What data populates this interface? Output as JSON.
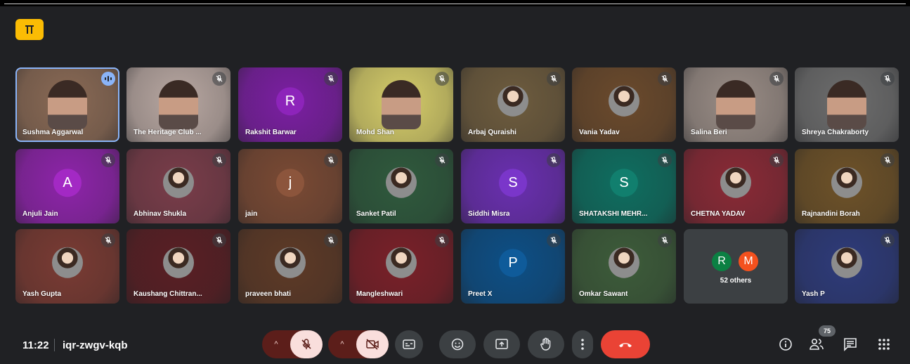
{
  "meeting": {
    "time": "11:22",
    "code": "iqr-zwgv-kqb",
    "participant_count": "75"
  },
  "tiles": [
    {
      "name": "Sushma Aggarwal",
      "icon": "speaking-icon",
      "bg": "#8a6a55",
      "kind": "video"
    },
    {
      "name": "The Heritage Club ...",
      "icon": "mic-off-icon",
      "bg": "#b9a8a2",
      "kind": "video"
    },
    {
      "name": "Rakshit Barwar",
      "icon": "mic-off-icon",
      "bg": "#7b1fa2",
      "kind": "letter",
      "letter": "R"
    },
    {
      "name": "Mohd Shan",
      "icon": "mic-off-icon",
      "bg": "#d6cd6a",
      "kind": "video"
    },
    {
      "name": "Arbaj Quraishi",
      "icon": "mic-off-icon",
      "bg": "#6e5c3e",
      "kind": "avatar"
    },
    {
      "name": "Vania Yadav",
      "icon": "mic-off-icon",
      "bg": "#6b4a2c",
      "kind": "avatar"
    },
    {
      "name": "Salina Beri",
      "icon": "mic-off-icon",
      "bg": "#9a8d86",
      "kind": "video"
    },
    {
      "name": "Shreya Chakraborty",
      "icon": "mic-off-icon",
      "bg": "#6d6d6d",
      "kind": "video"
    },
    {
      "name": "Anjuli Jain",
      "icon": "mic-off-icon",
      "bg": "#8e24aa",
      "kind": "letter",
      "letter": "A"
    },
    {
      "name": "Abhinav Shukla",
      "icon": "mic-off-icon",
      "bg": "#7a3d4a",
      "kind": "avatar"
    },
    {
      "name": "jain",
      "icon": "mic-off-icon",
      "bg": "#7a4a34",
      "kind": "letter",
      "letter": "j"
    },
    {
      "name": "Sanket Patil",
      "icon": "mic-off-icon",
      "bg": "#2f5a3d",
      "kind": "avatar"
    },
    {
      "name": "Siddhi Misra",
      "icon": "mic-off-icon",
      "bg": "#6a2fb0",
      "kind": "letter",
      "letter": "S"
    },
    {
      "name": "SHATAKSHI MEHR...",
      "icon": "mic-off-icon",
      "bg": "#0f6e60",
      "kind": "letter",
      "letter": "S"
    },
    {
      "name": "CHETNA YADAV",
      "icon": "mic-off-icon",
      "bg": "#8a2a36",
      "kind": "avatar"
    },
    {
      "name": "Rajnandini Borah",
      "icon": "mic-off-icon",
      "bg": "#6e5228",
      "kind": "avatar"
    },
    {
      "name": "Yash Gupta",
      "icon": "mic-off-icon",
      "bg": "#7a3b33",
      "kind": "avatar"
    },
    {
      "name": "Kaushang Chittran...",
      "icon": "mic-off-icon",
      "bg": "#5a1f24",
      "kind": "avatar"
    },
    {
      "name": "praveen bhati",
      "icon": "mic-off-icon",
      "bg": "#5e3a26",
      "kind": "avatar"
    },
    {
      "name": "Mangleshwari",
      "icon": "mic-off-icon",
      "bg": "#7a2028",
      "kind": "avatar"
    },
    {
      "name": "Preet X",
      "icon": "mic-off-icon",
      "bg": "#0d4f86",
      "kind": "letter",
      "letter": "P"
    },
    {
      "name": "Omkar Sawant",
      "icon": "mic-off-icon",
      "bg": "#3d5c3a",
      "kind": "avatar"
    },
    {
      "name": "others",
      "icon": "",
      "bg": "#3c4043",
      "kind": "others"
    },
    {
      "name": "Yash P",
      "icon": "mic-off-icon",
      "bg": "#2e3b7a",
      "kind": "avatar"
    }
  ],
  "others_tile": {
    "letter1": "R",
    "letter2": "M",
    "label": "52 others"
  },
  "controls": [
    "mic-toggle",
    "camera-toggle",
    "captions",
    "emoji",
    "present",
    "raise-hand",
    "more-options",
    "leave-call"
  ],
  "right_controls": [
    "meeting-info",
    "people",
    "chat",
    "activities"
  ]
}
